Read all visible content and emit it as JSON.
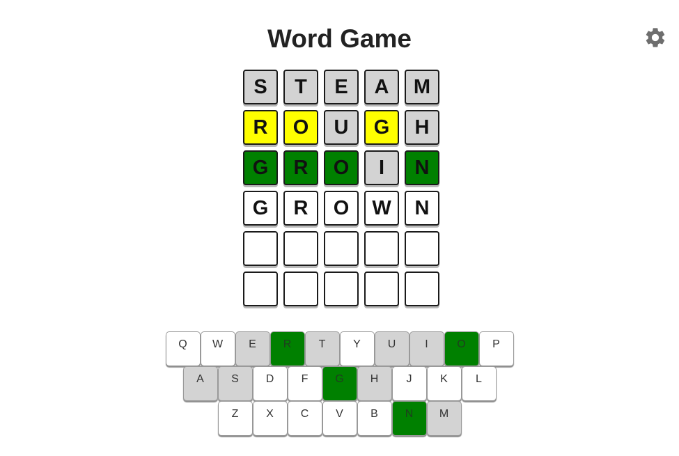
{
  "header": {
    "title": "Word Game",
    "settings_icon": "gear-icon"
  },
  "colors": {
    "correct": "#008000",
    "present": "#ffff00",
    "absent": "#d3d3d3",
    "empty": "#ffffff"
  },
  "board": {
    "rows": [
      {
        "letters": [
          "S",
          "T",
          "E",
          "A",
          "M"
        ],
        "states": [
          "absent",
          "absent",
          "absent",
          "absent",
          "absent"
        ]
      },
      {
        "letters": [
          "R",
          "O",
          "U",
          "G",
          "H"
        ],
        "states": [
          "present",
          "present",
          "absent",
          "present",
          "absent"
        ]
      },
      {
        "letters": [
          "G",
          "R",
          "O",
          "I",
          "N"
        ],
        "states": [
          "correct",
          "correct",
          "correct",
          "absent",
          "correct"
        ]
      },
      {
        "letters": [
          "G",
          "R",
          "O",
          "W",
          "N"
        ],
        "states": [
          "empty",
          "empty",
          "empty",
          "empty",
          "empty"
        ]
      },
      {
        "letters": [
          "",
          "",
          "",
          "",
          ""
        ],
        "states": [
          "empty",
          "empty",
          "empty",
          "empty",
          "empty"
        ]
      },
      {
        "letters": [
          "",
          "",
          "",
          "",
          ""
        ],
        "states": [
          "empty",
          "empty",
          "empty",
          "empty",
          "empty"
        ]
      }
    ]
  },
  "keyboard": {
    "rows": [
      [
        {
          "label": "Q",
          "state": "empty"
        },
        {
          "label": "W",
          "state": "empty"
        },
        {
          "label": "E",
          "state": "absent"
        },
        {
          "label": "R",
          "state": "correct"
        },
        {
          "label": "T",
          "state": "absent"
        },
        {
          "label": "Y",
          "state": "empty"
        },
        {
          "label": "U",
          "state": "absent"
        },
        {
          "label": "I",
          "state": "absent"
        },
        {
          "label": "O",
          "state": "correct"
        },
        {
          "label": "P",
          "state": "empty"
        }
      ],
      [
        {
          "label": "A",
          "state": "absent"
        },
        {
          "label": "S",
          "state": "absent"
        },
        {
          "label": "D",
          "state": "empty"
        },
        {
          "label": "F",
          "state": "empty"
        },
        {
          "label": "G",
          "state": "correct"
        },
        {
          "label": "H",
          "state": "absent"
        },
        {
          "label": "J",
          "state": "empty"
        },
        {
          "label": "K",
          "state": "empty"
        },
        {
          "label": "L",
          "state": "empty"
        }
      ],
      [
        {
          "label": "Z",
          "state": "empty"
        },
        {
          "label": "X",
          "state": "empty"
        },
        {
          "label": "C",
          "state": "empty"
        },
        {
          "label": "V",
          "state": "empty"
        },
        {
          "label": "B",
          "state": "empty"
        },
        {
          "label": "N",
          "state": "correct"
        },
        {
          "label": "M",
          "state": "absent"
        }
      ]
    ]
  }
}
